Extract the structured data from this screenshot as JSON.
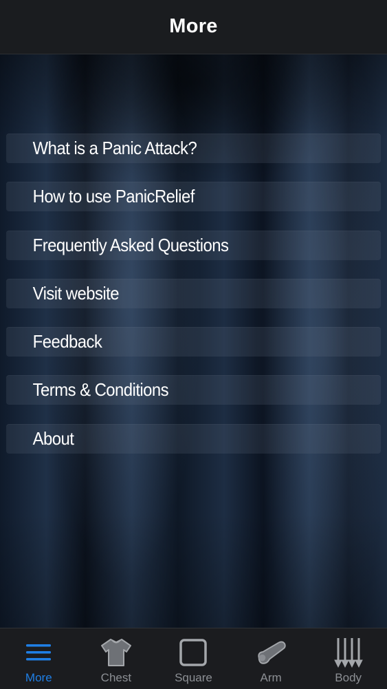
{
  "header": {
    "title": "More"
  },
  "menu": {
    "items": [
      {
        "label": "What is a Panic Attack?"
      },
      {
        "label": "How to use PanicRelief"
      },
      {
        "label": "Frequently Asked Questions"
      },
      {
        "label": "Visit website"
      },
      {
        "label": "Feedback"
      },
      {
        "label": "Terms & Conditions"
      },
      {
        "label": "About"
      }
    ]
  },
  "tab_bar": {
    "active_color": "#1f7fe6",
    "inactive_color": "#8c8f94",
    "tabs": [
      {
        "label": "More",
        "icon": "hamburger-menu-icon",
        "active": true
      },
      {
        "label": "Chest",
        "icon": "t-shirt-icon",
        "active": false
      },
      {
        "label": "Square",
        "icon": "square-icon",
        "active": false
      },
      {
        "label": "Arm",
        "icon": "arm-icon",
        "active": false
      },
      {
        "label": "Body",
        "icon": "down-arrows-icon",
        "active": false
      }
    ]
  }
}
